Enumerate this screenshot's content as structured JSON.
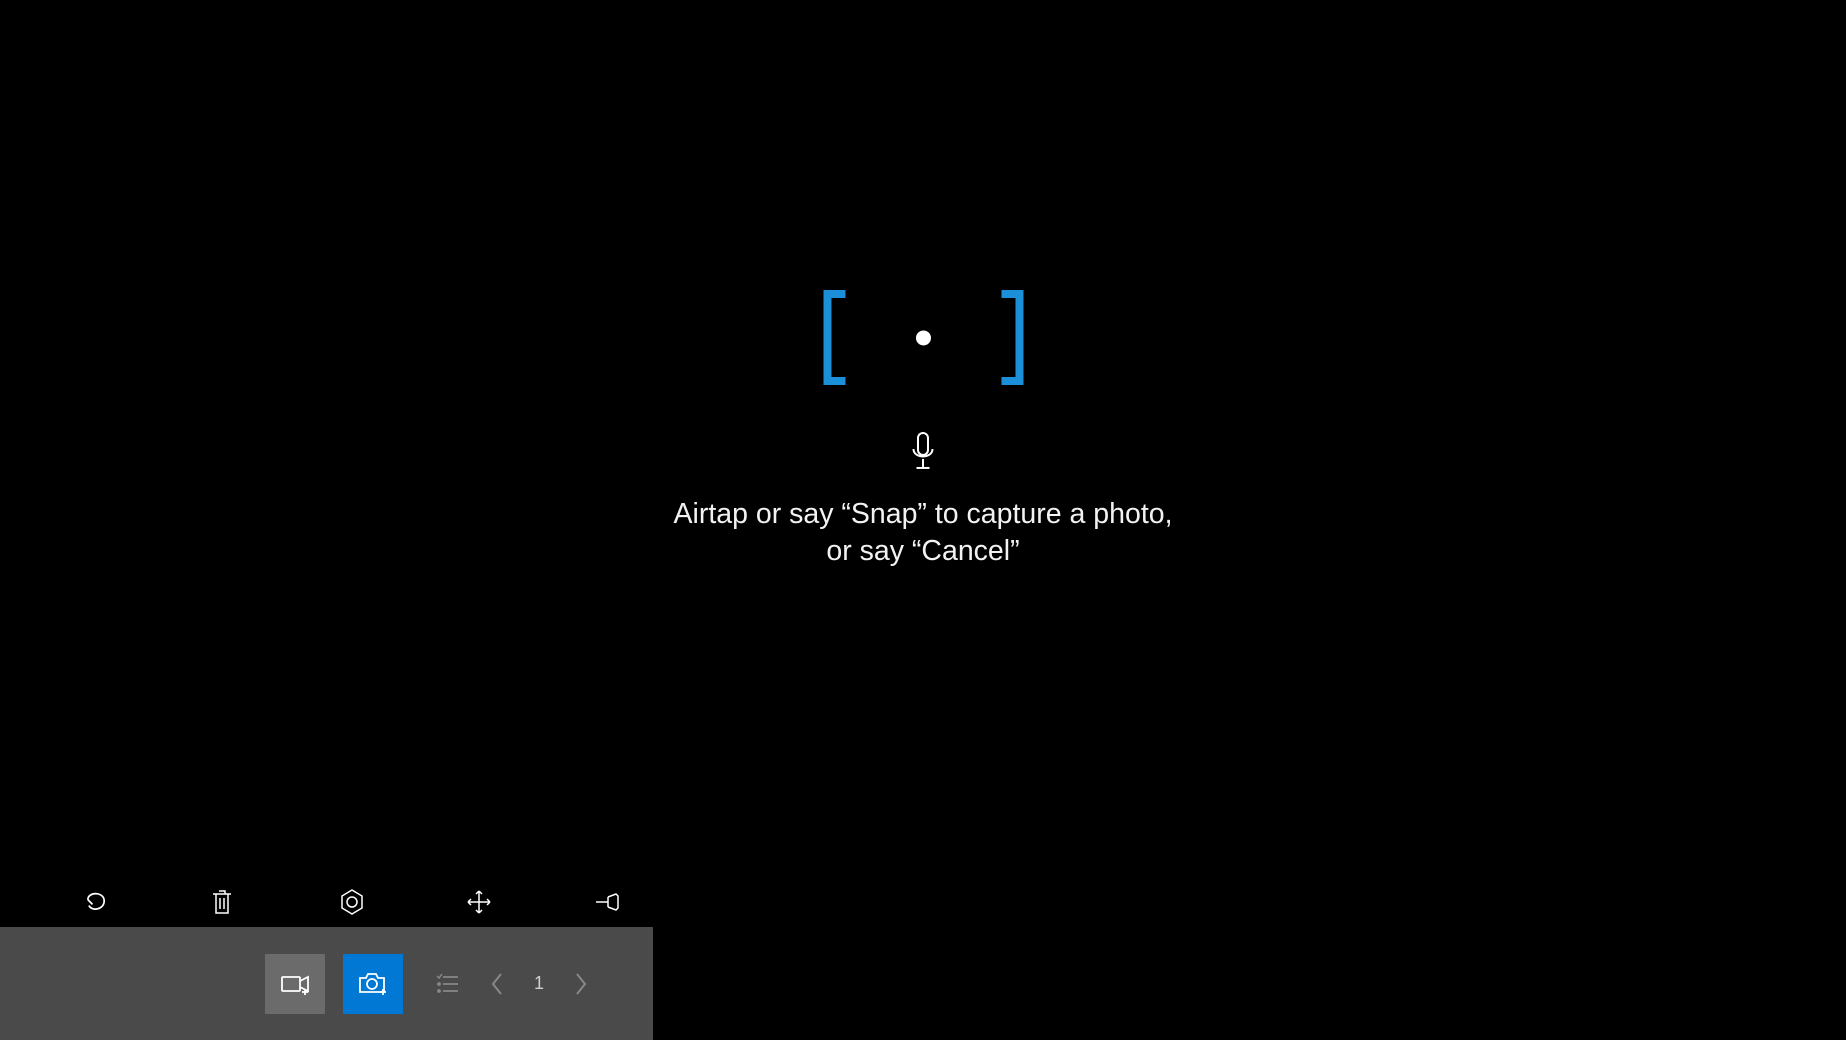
{
  "viewfinder": {
    "instruction_line1": "Airtap or say “Snap” to capture a photo,",
    "instruction_line2": "or say “Cancel”"
  },
  "toolbar": {
    "undo": "undo",
    "delete": "delete",
    "target": "target",
    "move": "move",
    "pin": "pin"
  },
  "bottombar": {
    "page_number": "1"
  }
}
